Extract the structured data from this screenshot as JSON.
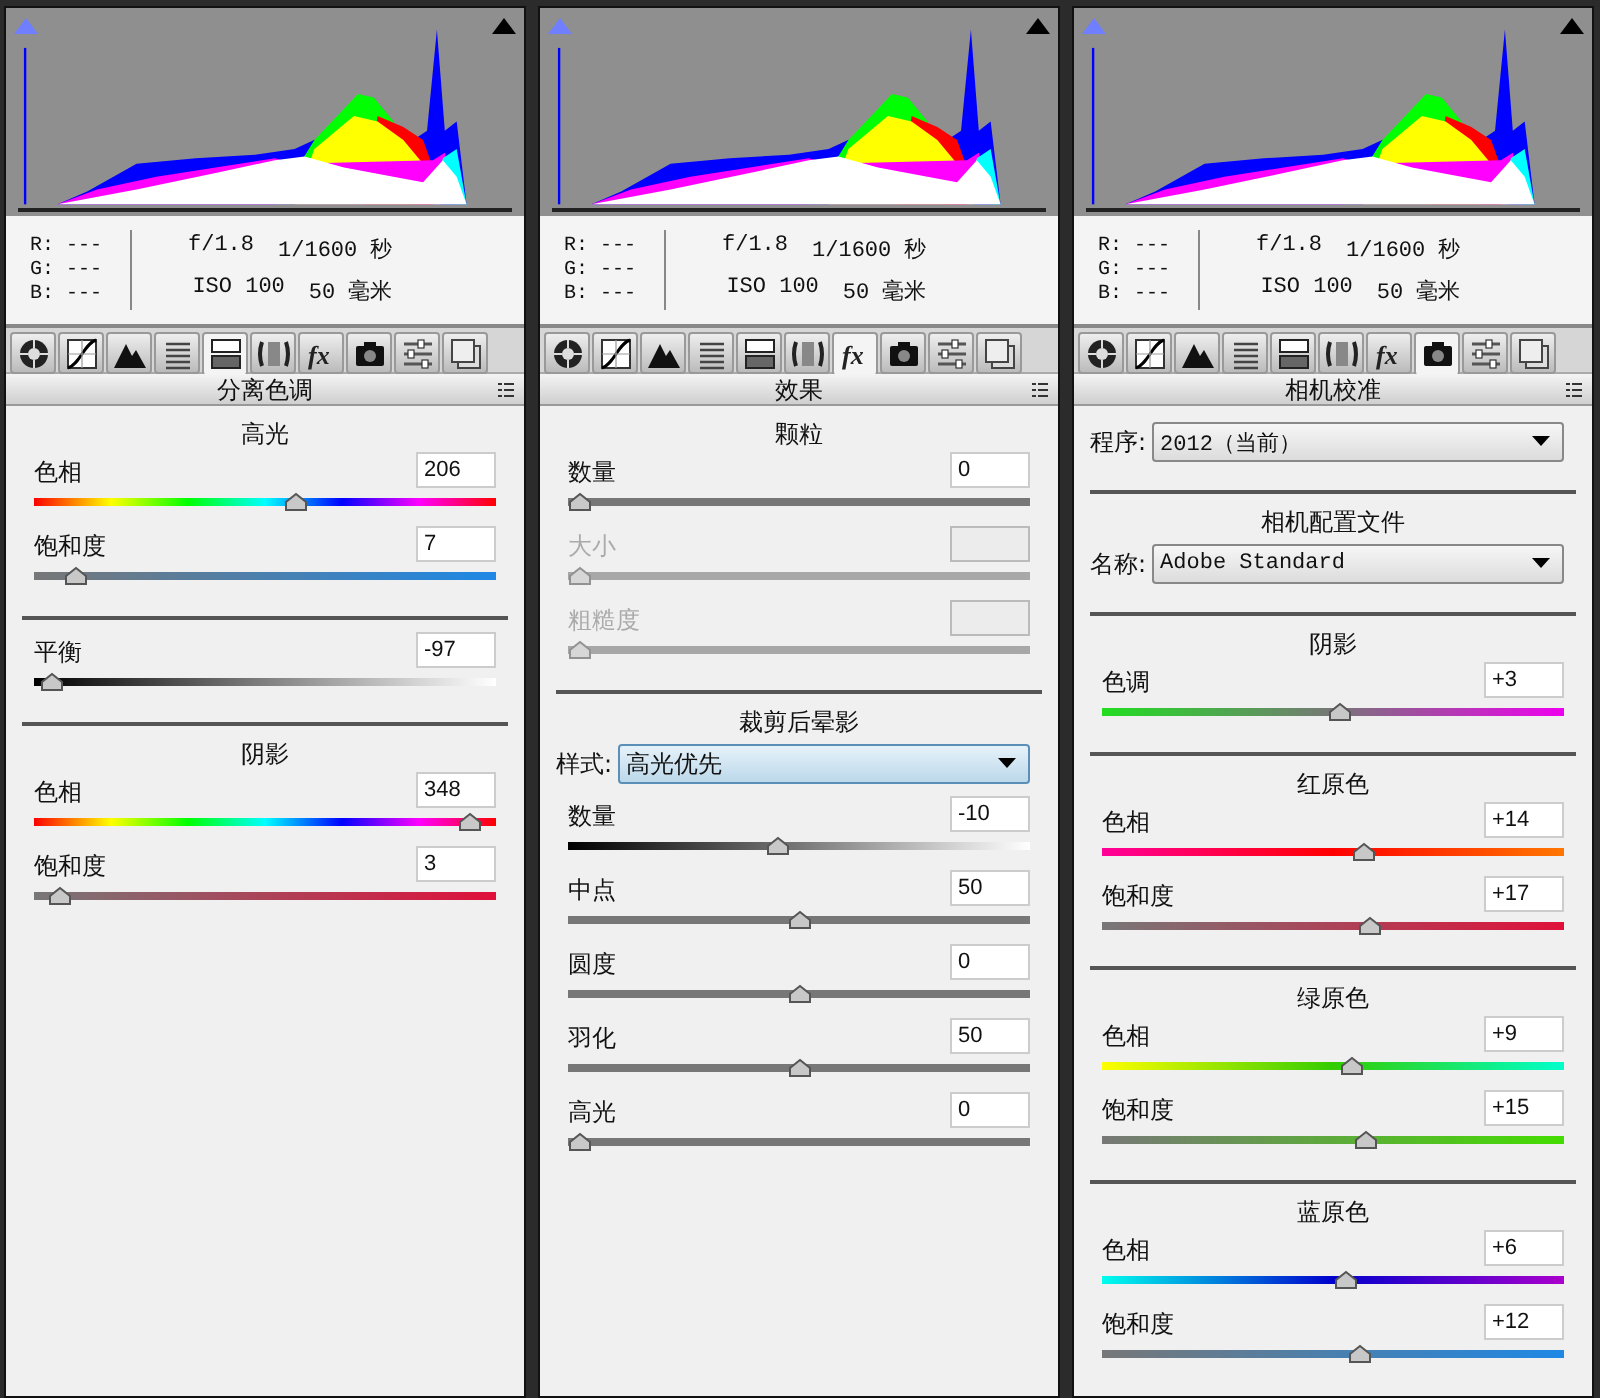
{
  "panels": [
    {
      "info": {
        "r": "R: ---",
        "g": "G: ---",
        "b": "B: ---",
        "aperture": "f/1.8",
        "shutter": "1/1600 秒",
        "iso": "ISO 100",
        "focal": "50 毫米"
      },
      "tabs": [
        {
          "kind": "aperture",
          "selected": false
        },
        {
          "kind": "curve",
          "selected": false
        },
        {
          "kind": "peaks",
          "selected": false
        },
        {
          "kind": "lines",
          "selected": false
        },
        {
          "kind": "split",
          "selected": true
        },
        {
          "kind": "lens",
          "selected": false
        },
        {
          "kind": "fx",
          "selected": false
        },
        {
          "kind": "camera",
          "selected": false
        },
        {
          "kind": "sliders",
          "selected": false
        },
        {
          "kind": "stack",
          "selected": false
        }
      ],
      "title": "分离色调",
      "sections": [
        {
          "heading": "高光",
          "rows": [
            {
              "kind": "hue",
              "label": "色相",
              "value": "206",
              "level": 0.57,
              "disabled": false
            },
            {
              "kind": "blues",
              "label": "饱和度",
              "value": "7",
              "level": 0.07,
              "disabled": false
            }
          ]
        },
        {
          "rows": [
            {
              "kind": "balance",
              "label": "平衡",
              "value": "-97",
              "level": 0.015,
              "disabled": false
            }
          ]
        },
        {
          "heading": "阴影",
          "rows": [
            {
              "kind": "hue",
              "label": "色相",
              "value": "348",
              "level": 0.967,
              "disabled": false
            },
            {
              "kind": "reds",
              "label": "饱和度",
              "value": "3",
              "level": 0.03,
              "disabled": false
            }
          ]
        }
      ]
    },
    {
      "info": {
        "r": "R: ---",
        "g": "G: ---",
        "b": "B: ---",
        "aperture": "f/1.8",
        "shutter": "1/1600 秒",
        "iso": "ISO 100",
        "focal": "50 毫米"
      },
      "tabs": [
        {
          "kind": "aperture",
          "selected": false
        },
        {
          "kind": "curve",
          "selected": false
        },
        {
          "kind": "peaks",
          "selected": false
        },
        {
          "kind": "lines",
          "selected": false
        },
        {
          "kind": "split",
          "selected": false
        },
        {
          "kind": "lens",
          "selected": false
        },
        {
          "kind": "fx",
          "selected": true
        },
        {
          "kind": "camera",
          "selected": false
        },
        {
          "kind": "sliders",
          "selected": false
        },
        {
          "kind": "stack",
          "selected": false
        }
      ],
      "title": "效果",
      "sections": [
        {
          "heading": "颗粒",
          "rows": [
            {
              "kind": "plain",
              "label": "数量",
              "value": "0",
              "level": 0,
              "disabled": false
            },
            {
              "kind": "plain",
              "label": "大小",
              "level": 0,
              "disabled": true
            },
            {
              "kind": "plain",
              "label": "粗糙度",
              "level": 0,
              "disabled": true
            }
          ]
        },
        {
          "heading": "裁剪后晕影",
          "rows": [
            {
              "kind": "dropdown",
              "label": "样式:",
              "value": "高光优先",
              "focused": true
            },
            {
              "kind": "vignette",
              "label": "数量",
              "value": "-10",
              "level": 0.45,
              "disabled": false
            },
            {
              "kind": "plain",
              "label": "中点",
              "value": "50",
              "level": 0.5,
              "disabled": false
            },
            {
              "kind": "plain",
              "label": "圆度",
              "value": "0",
              "level": 0.5,
              "disabled": false
            },
            {
              "kind": "plain",
              "label": "羽化",
              "value": "50",
              "level": 0.5,
              "disabled": false
            },
            {
              "kind": "plain",
              "label": "高光",
              "value": "0",
              "level": 0,
              "disabled": false
            }
          ]
        }
      ]
    },
    {
      "info": {
        "r": "R: ---",
        "g": "G: ---",
        "b": "B: ---",
        "aperture": "f/1.8",
        "shutter": "1/1600 秒",
        "iso": "ISO 100",
        "focal": "50 毫米"
      },
      "tabs": [
        {
          "kind": "aperture",
          "selected": false
        },
        {
          "kind": "curve",
          "selected": false
        },
        {
          "kind": "peaks",
          "selected": false
        },
        {
          "kind": "lines",
          "selected": false
        },
        {
          "kind": "split",
          "selected": false
        },
        {
          "kind": "lens",
          "selected": false
        },
        {
          "kind": "fx",
          "selected": false
        },
        {
          "kind": "camera",
          "selected": true
        },
        {
          "kind": "sliders",
          "selected": false
        },
        {
          "kind": "stack",
          "selected": false
        }
      ],
      "title": "相机校准",
      "sections": [
        {
          "rows": [
            {
              "kind": "dropdown",
              "label": "程序:",
              "value": "2012（当前）",
              "focused": false
            }
          ]
        },
        {
          "heading": "相机配置文件",
          "rows": [
            {
              "kind": "dropdown",
              "label": "名称:",
              "value": "Adobe Standard",
              "focused": false
            }
          ]
        },
        {
          "heading": "阴影",
          "rows": [
            {
              "kind": "tint",
              "label": "色调",
              "value": "+3",
              "level": 0.515,
              "disabled": false
            }
          ]
        },
        {
          "heading": "红原色",
          "rows": [
            {
              "kind": "redhue",
              "label": "色相",
              "value": "+14",
              "level": 0.57,
              "disabled": false
            },
            {
              "kind": "reds",
              "label": "饱和度",
              "value": "+17",
              "level": 0.585,
              "disabled": false
            }
          ]
        },
        {
          "heading": "绿原色",
          "rows": [
            {
              "kind": "greenhue",
              "label": "色相",
              "value": "+9",
              "level": 0.545,
              "disabled": false
            },
            {
              "kind": "greens",
              "label": "饱和度",
              "value": "+15",
              "level": 0.575,
              "disabled": false
            }
          ]
        },
        {
          "heading": "蓝原色",
          "rows": [
            {
              "kind": "bluehue",
              "label": "色相",
              "value": "+6",
              "level": 0.53,
              "disabled": false
            },
            {
              "kind": "blues",
              "label": "饱和度",
              "value": "+12",
              "level": 0.56,
              "disabled": false
            }
          ]
        }
      ]
    }
  ]
}
